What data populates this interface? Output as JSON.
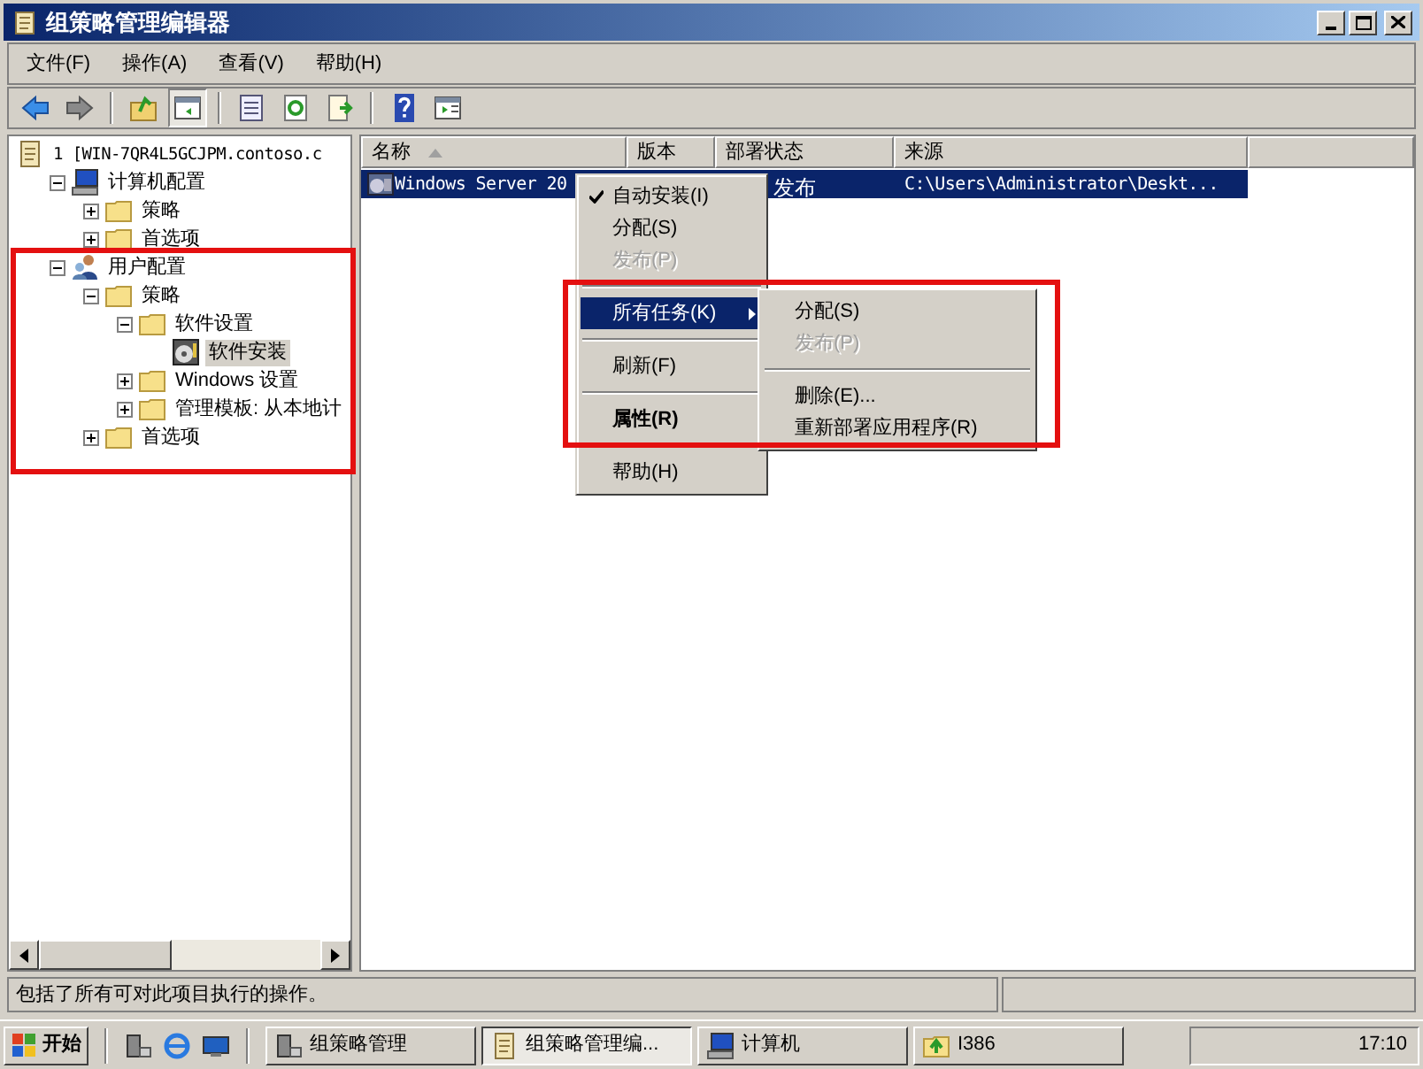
{
  "window": {
    "title": "组策略管理编辑器"
  },
  "menu_bar": [
    "文件(F)",
    "操作(A)",
    "查看(V)",
    "帮助(H)"
  ],
  "toolbar": [
    {
      "kind": "back"
    },
    {
      "kind": "forward"
    },
    {
      "kind": "sep"
    },
    {
      "kind": "up"
    },
    {
      "kind": "pane",
      "selected": true
    },
    {
      "kind": "sep"
    },
    {
      "kind": "list"
    },
    {
      "kind": "refresh"
    },
    {
      "kind": "export"
    },
    {
      "kind": "sep"
    },
    {
      "kind": "help"
    },
    {
      "kind": "panel"
    }
  ],
  "tree": [
    {
      "label": "1 [WIN-7QR4L5GCJPM.contoso.c",
      "kind": "root",
      "children": [
        {
          "label": "计算机配置",
          "kind": "computer",
          "expanded": true,
          "children": [
            {
              "label": "策略",
              "kind": "folder",
              "expanded": false
            },
            {
              "label": "首选项",
              "kind": "folder",
              "expanded": false
            }
          ]
        },
        {
          "label": "用户配置",
          "kind": "user",
          "expanded": true,
          "children": [
            {
              "label": "策略",
              "kind": "folder",
              "expanded": true,
              "children": [
                {
                  "label": "软件设置",
                  "kind": "folder",
                  "expanded": true,
                  "children": [
                    {
                      "label": "软件安装",
                      "kind": "software",
                      "selected": true
                    }
                  ]
                },
                {
                  "label": "Windows 设置",
                  "kind": "folder",
                  "expanded": false
                },
                {
                  "label": "管理模板: 从本地计",
                  "kind": "folder",
                  "expanded": false
                }
              ]
            },
            {
              "label": "首选项",
              "kind": "folder",
              "expanded": false
            }
          ]
        }
      ]
    }
  ],
  "table": {
    "columns": [
      {
        "label": "名称",
        "sorted": true
      },
      {
        "label": "版本",
        "sorted": false
      },
      {
        "label": "部署状态",
        "sorted": false
      },
      {
        "label": "来源",
        "sorted": false
      }
    ],
    "rows": [
      {
        "selected": true,
        "cells": [
          "Windows Server 20",
          "",
          "发布",
          "C:\\Users\\Administrator\\Deskt..."
        ]
      }
    ]
  },
  "context_menu": [
    {
      "kind": "item",
      "label": "自动安装(I)",
      "checked": true,
      "disabled": false
    },
    {
      "kind": "item",
      "label": "分配(S)",
      "checked": false,
      "disabled": false
    },
    {
      "kind": "item",
      "label": "发布(P)",
      "checked": false,
      "disabled": true
    },
    {
      "kind": "separator"
    },
    {
      "kind": "submenu",
      "label": "所有任务(K)",
      "selected": true
    },
    {
      "kind": "separator"
    },
    {
      "kind": "item",
      "label": "刷新(F)",
      "checked": false,
      "disabled": false
    },
    {
      "kind": "separator"
    },
    {
      "kind": "item",
      "label": "属性(R)",
      "checked": false,
      "disabled": false,
      "default": true
    },
    {
      "kind": "separator"
    },
    {
      "kind": "item",
      "label": "帮助(H)",
      "checked": false,
      "disabled": false
    }
  ],
  "submenu": [
    {
      "kind": "item",
      "label": "分配(S)",
      "disabled": false
    },
    {
      "kind": "item",
      "label": "发布(P)",
      "disabled": true
    },
    {
      "kind": "separator"
    },
    {
      "kind": "item",
      "label": "删除(E)...",
      "disabled": false
    },
    {
      "kind": "item",
      "label": "重新部署应用程序(R)",
      "disabled": false
    }
  ],
  "status_bar": "包括了所有可对此项目执行的操作。",
  "taskbar": {
    "start": "开始",
    "quick_launch": [
      {
        "kind": "server"
      },
      {
        "kind": "browser"
      },
      {
        "kind": "desktop"
      }
    ],
    "tasks": [
      {
        "label": "组策略管理",
        "kind": "server",
        "selected": false
      },
      {
        "label": "组策略管理编...",
        "kind": "scroll",
        "selected": true
      },
      {
        "label": "计算机",
        "kind": "computer",
        "selected": false
      },
      {
        "label": "I386",
        "kind": "folder",
        "selected": false
      }
    ],
    "clock": "17:10"
  }
}
